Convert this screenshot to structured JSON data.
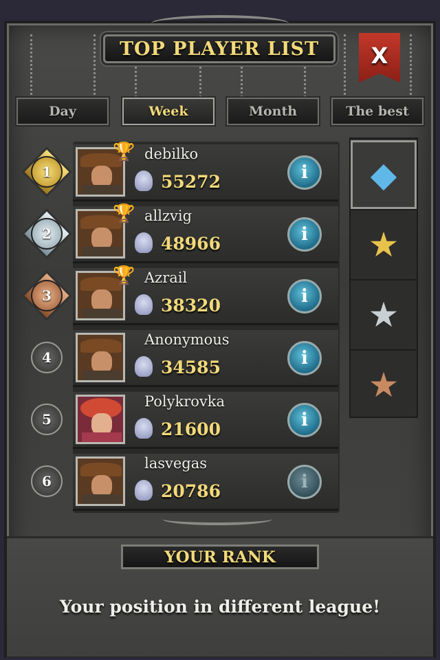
{
  "header": {
    "title": "TOP PLAYER LIST",
    "close_label": "X"
  },
  "tabs": [
    {
      "label": "Day",
      "active": false
    },
    {
      "label": "Week",
      "active": true
    },
    {
      "label": "Month",
      "active": false
    },
    {
      "label": "The best",
      "active": false
    }
  ],
  "players": [
    {
      "rank": "1",
      "name": "debilko",
      "score": "55272",
      "trophy": "gold"
    },
    {
      "rank": "2",
      "name": "allzvig",
      "score": "48966",
      "trophy": "silver"
    },
    {
      "rank": "3",
      "name": "Azrail",
      "score": "38320",
      "trophy": "gold"
    },
    {
      "rank": "4",
      "name": "Anonymous",
      "score": "34585",
      "trophy": ""
    },
    {
      "rank": "5",
      "name": "Polykrovka",
      "score": "21600",
      "trophy": ""
    },
    {
      "rank": "6",
      "name": "lasvegas",
      "score": "20786",
      "trophy": ""
    }
  ],
  "leagues": [
    "diamond-league-icon",
    "gold-league-icon",
    "silver-league-icon",
    "bronze-league-icon"
  ],
  "your_rank": {
    "title": "YOUR RANK",
    "message": "Your position in different league!"
  },
  "colors": {
    "accent_gold": "#f2d97a",
    "close_red": "#c2382a",
    "info_blue": "#1f6c8a"
  }
}
